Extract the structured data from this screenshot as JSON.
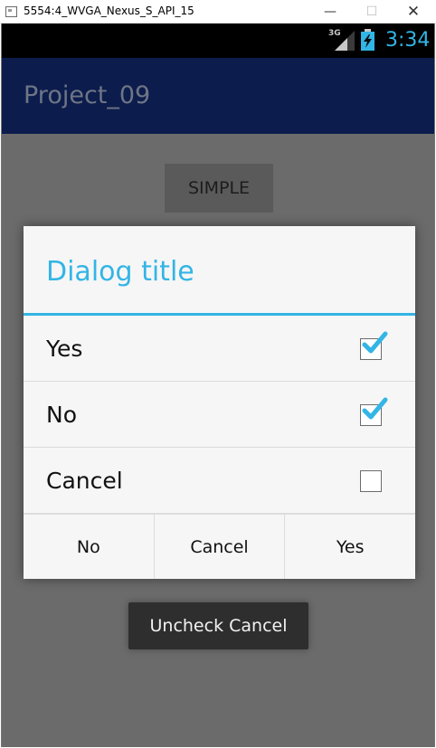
{
  "window": {
    "title": "5554:4_WVGA_Nexus_S_API_15",
    "minimize": "—",
    "maximize": "☐",
    "close": "✕"
  },
  "status_bar": {
    "network": "3G",
    "time": "3:34"
  },
  "action_bar": {
    "title": "Project_09"
  },
  "main": {
    "simple_button": "SIMPLE"
  },
  "dialog": {
    "title": "Dialog title",
    "items": [
      {
        "label": "Yes",
        "checked": true
      },
      {
        "label": "No",
        "checked": true
      },
      {
        "label": "Cancel",
        "checked": false
      }
    ],
    "buttons": {
      "negative": "No",
      "neutral": "Cancel",
      "positive": "Yes"
    }
  },
  "toast": {
    "text": "Uncheck Cancel"
  },
  "colors": {
    "accent": "#33b5e5",
    "action_bar": "#0c1c4d",
    "dim_background": "#6b6b6c"
  }
}
